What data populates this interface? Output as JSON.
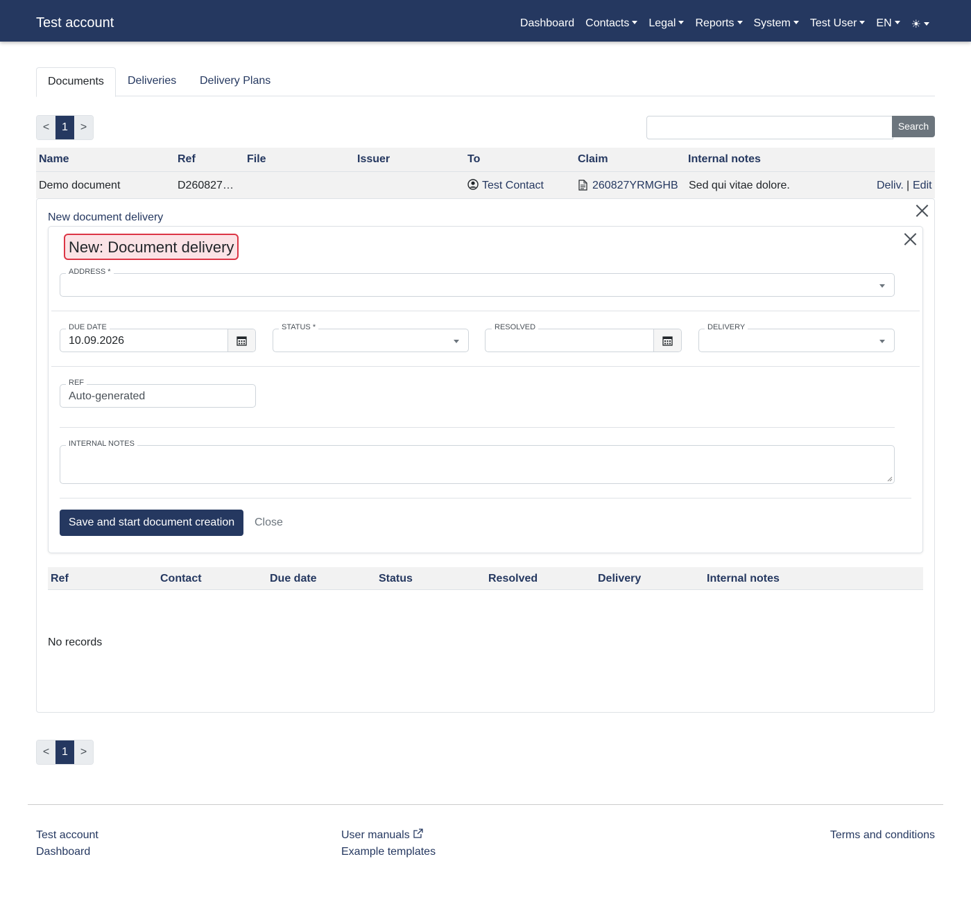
{
  "navbar": {
    "brand": "Test account",
    "links": [
      {
        "label": "Dashboard",
        "dropdown": false
      },
      {
        "label": "Contacts",
        "dropdown": true
      },
      {
        "label": "Legal",
        "dropdown": true
      },
      {
        "label": "Reports",
        "dropdown": true
      },
      {
        "label": "System",
        "dropdown": true
      },
      {
        "label": "Test User",
        "dropdown": true
      },
      {
        "label": "EN",
        "dropdown": true
      },
      {
        "label": "☀",
        "dropdown": true
      }
    ]
  },
  "tabs": [
    "Documents",
    "Deliveries",
    "Delivery Plans"
  ],
  "pagination": {
    "prev": "<",
    "current": "1",
    "next": ">"
  },
  "search": {
    "button": "Search",
    "value": ""
  },
  "table": {
    "columns": [
      "Name",
      "Ref",
      "File",
      "Issuer",
      "To",
      "Claim",
      "Internal notes"
    ],
    "row": {
      "name": "Demo document",
      "ref": "D260827…",
      "file": "",
      "issuer": "",
      "to": "Test Contact",
      "claim": "260827YRMGHB",
      "notes": "Sed qui vitae dolore.",
      "actions": {
        "deliv": "Deliv.",
        "sep": "|",
        "edit": "Edit"
      }
    }
  },
  "panel": {
    "link": "New document delivery",
    "form": {
      "title": "New: Document delivery",
      "address": {
        "label": "ADDRESS *",
        "value": ""
      },
      "due_date": {
        "label": "DUE DATE",
        "value": "10.09.2026"
      },
      "status": {
        "label": "STATUS *",
        "value": ""
      },
      "resolved": {
        "label": "RESOLVED",
        "value": ""
      },
      "delivery": {
        "label": "DELIVERY",
        "value": ""
      },
      "ref": {
        "label": "REF",
        "placeholder": "Auto-generated"
      },
      "internal_notes": {
        "label": "INTERNAL NOTES",
        "value": ""
      },
      "save_label": "Save and start document creation",
      "close_label": "Close"
    },
    "sub_table": {
      "columns": [
        "Ref",
        "Contact",
        "Due date",
        "Status",
        "Resolved",
        "Delivery",
        "Internal notes"
      ],
      "empty": "No records"
    }
  },
  "footer": {
    "col1": [
      "Test account",
      "Dashboard"
    ],
    "col2": [
      "User manuals",
      "Example templates"
    ],
    "col3": [
      "Terms and conditions"
    ]
  },
  "colors": {
    "primary": "#253860",
    "highlight_border": "#dc3545",
    "highlight_bg": "#fbe3e6"
  }
}
